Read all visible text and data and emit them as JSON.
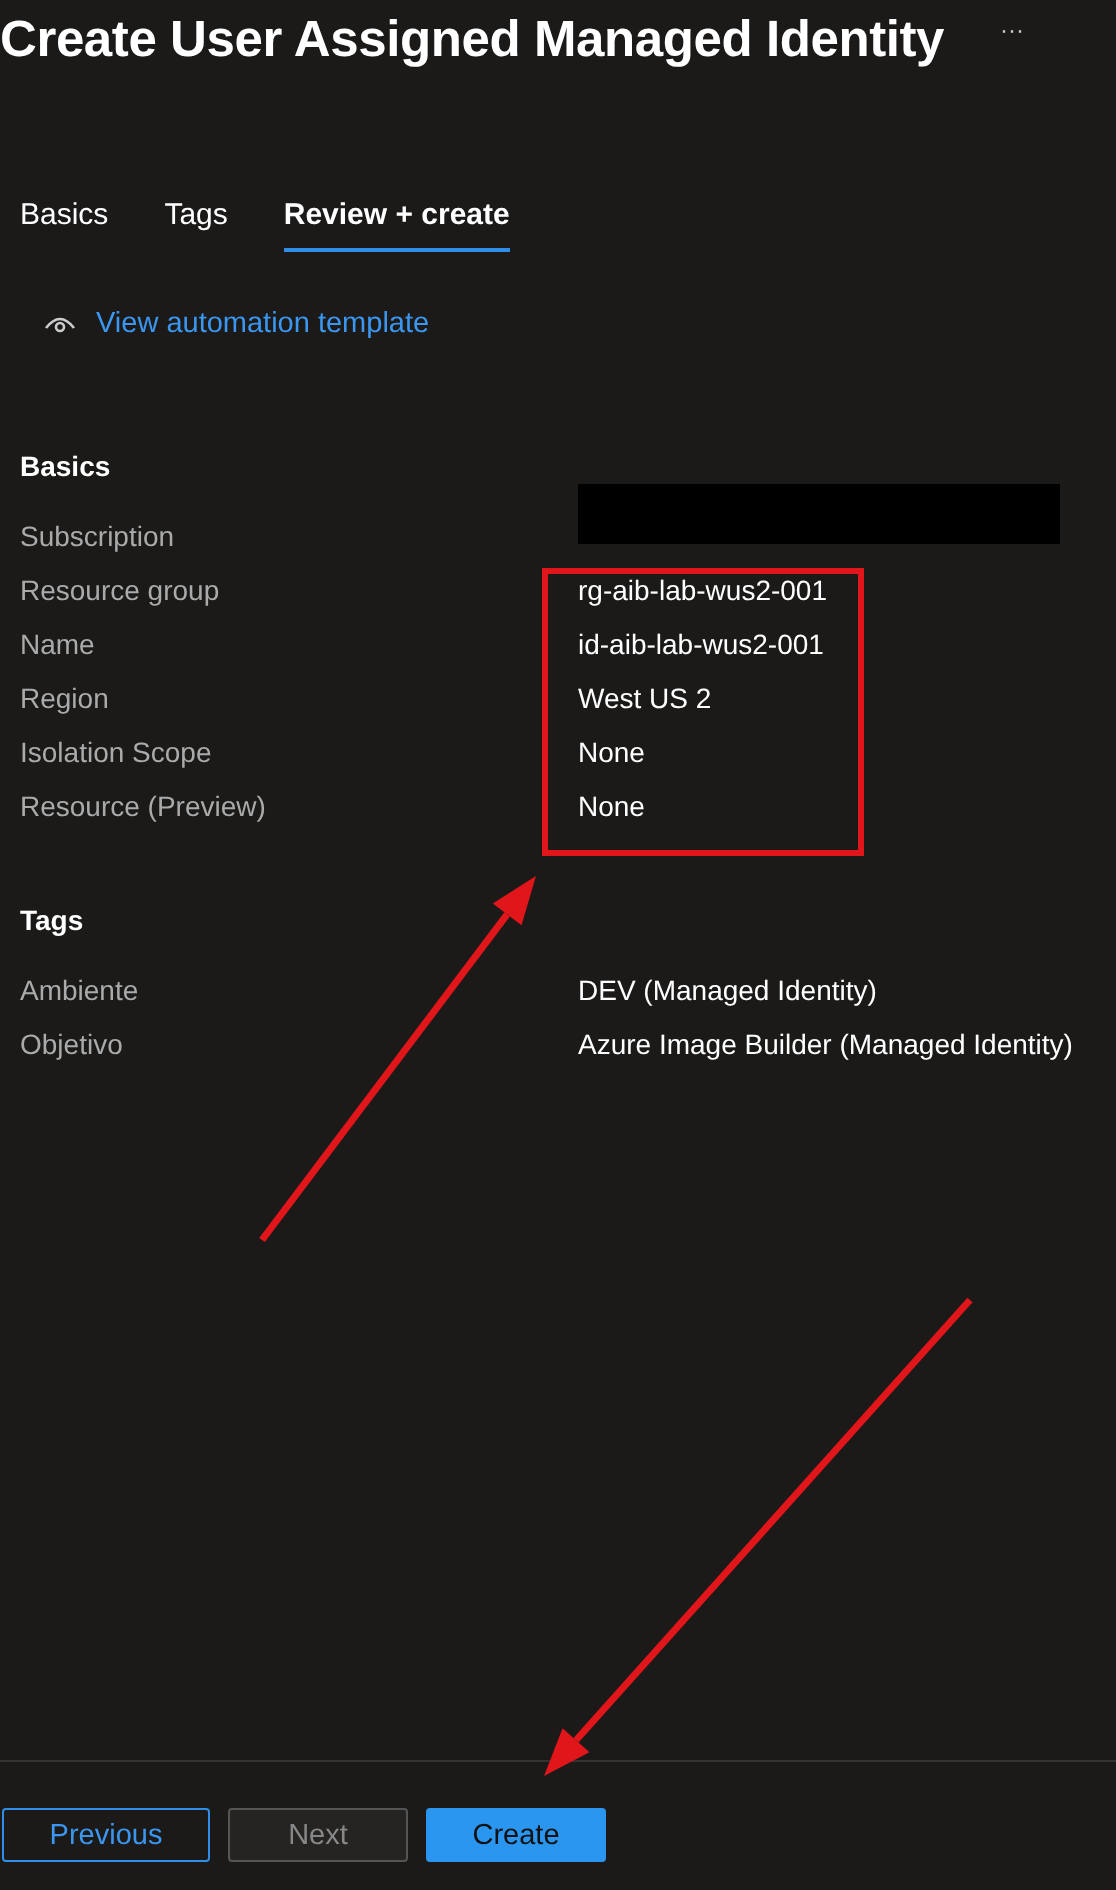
{
  "header": {
    "title": "Create User Assigned Managed Identity",
    "more": "···"
  },
  "tabs": [
    {
      "label": "Basics",
      "selected": false
    },
    {
      "label": "Tags",
      "selected": false
    },
    {
      "label": "Review + create",
      "selected": true
    }
  ],
  "template_link": "View automation template",
  "sections": [
    {
      "heading": "Basics",
      "rows": [
        {
          "label": "Subscription",
          "redacted": true
        },
        {
          "label": "Resource group",
          "value": "rg-aib-lab-wus2-001",
          "redacted": false
        },
        {
          "label": "Name",
          "value": "id-aib-lab-wus2-001",
          "redacted": false
        },
        {
          "label": "Region",
          "value": "West US 2",
          "redacted": false
        },
        {
          "label": "Isolation Scope",
          "value": "None",
          "redacted": false
        },
        {
          "label": "Resource (Preview)",
          "value": "None",
          "redacted": false
        }
      ]
    },
    {
      "heading": "Tags",
      "rows": [
        {
          "label": "Ambiente",
          "value": "DEV (Managed Identity)",
          "redacted": false
        },
        {
          "label": "Objetivo",
          "value": "Azure Image Builder (Managed Identity)",
          "redacted": false
        }
      ]
    }
  ],
  "footer": {
    "buttons": [
      {
        "label": "Previous",
        "kind": "outline",
        "disabled": false
      },
      {
        "label": "Next",
        "kind": "outline",
        "disabled": true
      },
      {
        "label": "Create",
        "kind": "primary",
        "disabled": false
      }
    ]
  },
  "annotations": [
    {
      "kind": "highlight"
    },
    {
      "kind": "arrow"
    },
    {
      "kind": "arrow"
    }
  ]
}
